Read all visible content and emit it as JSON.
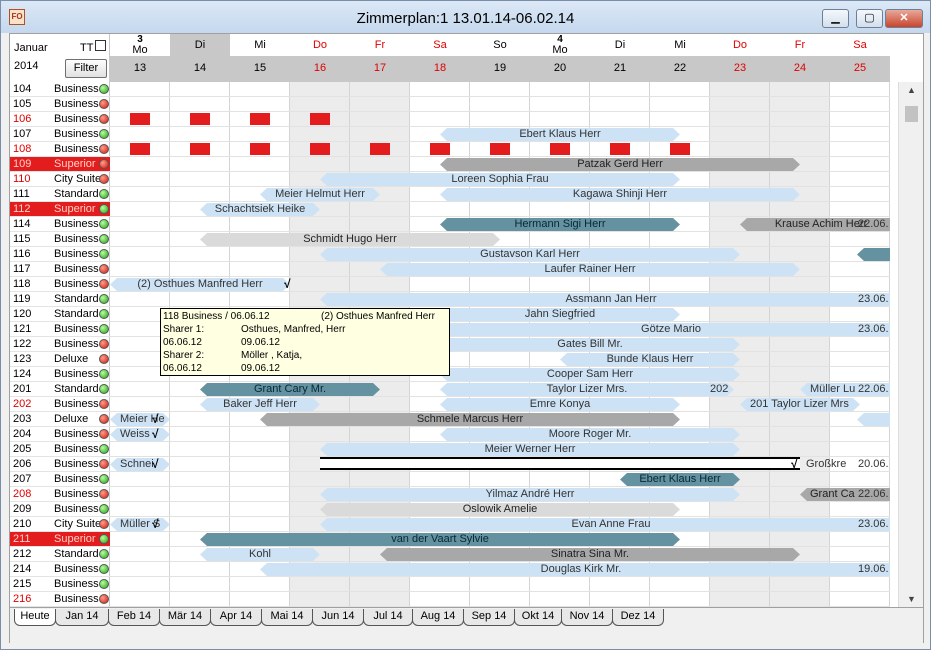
{
  "window": {
    "title": "Zimmerplan:1 13.01.14-06.02.14",
    "app_icon_label": "FO",
    "min_glyph": "▁",
    "max_glyph": "▢",
    "close_glyph": "✕"
  },
  "header": {
    "month": "Januar",
    "year": "2014",
    "tt_label": "TT",
    "filter_label": "Filter"
  },
  "days": [
    {
      "kw": "3",
      "wd": "Mo",
      "num": "13",
      "red": false,
      "today": false
    },
    {
      "kw": "",
      "wd": "Di",
      "num": "14",
      "red": false,
      "today": true
    },
    {
      "kw": "",
      "wd": "Mi",
      "num": "15",
      "red": false,
      "today": false
    },
    {
      "kw": "",
      "wd": "Do",
      "num": "16",
      "red": true,
      "today": false
    },
    {
      "kw": "",
      "wd": "Fr",
      "num": "17",
      "red": true,
      "today": false
    },
    {
      "kw": "",
      "wd": "Sa",
      "num": "18",
      "red": true,
      "today": false
    },
    {
      "kw": "",
      "wd": "So",
      "num": "19",
      "red": false,
      "today": false
    },
    {
      "kw": "4",
      "wd": "Mo",
      "num": "20",
      "red": false,
      "today": false
    },
    {
      "kw": "",
      "wd": "Di",
      "num": "21",
      "red": false,
      "today": false
    },
    {
      "kw": "",
      "wd": "Mi",
      "num": "22",
      "red": false,
      "today": false
    },
    {
      "kw": "",
      "wd": "Do",
      "num": "23",
      "red": true,
      "today": false
    },
    {
      "kw": "",
      "wd": "Fr",
      "num": "24",
      "red": true,
      "today": false
    },
    {
      "kw": "",
      "wd": "Sa",
      "num": "25",
      "red": true,
      "today": false
    }
  ],
  "weekend_columns": [
    3,
    4,
    10,
    11
  ],
  "rooms": [
    {
      "num": "104",
      "cat": "Business",
      "status": "g",
      "red": false,
      "blocked": false
    },
    {
      "num": "105",
      "cat": "Business",
      "status": "r",
      "red": false,
      "blocked": false
    },
    {
      "num": "106",
      "cat": "Business",
      "status": "r",
      "red": true,
      "blocked": false
    },
    {
      "num": "107",
      "cat": "Business",
      "status": "g",
      "red": false,
      "blocked": false
    },
    {
      "num": "108",
      "cat": "Business",
      "status": "r",
      "red": true,
      "blocked": false
    },
    {
      "num": "109",
      "cat": "Superior",
      "status": "r",
      "red": false,
      "blocked": true
    },
    {
      "num": "110",
      "cat": "City Suite",
      "status": "r",
      "red": true,
      "blocked": false
    },
    {
      "num": "111",
      "cat": "Standard",
      "status": "g",
      "red": false,
      "blocked": false
    },
    {
      "num": "112",
      "cat": "Superior",
      "status": "g",
      "red": false,
      "blocked": true
    },
    {
      "num": "114",
      "cat": "Business",
      "status": "g",
      "red": false,
      "blocked": false
    },
    {
      "num": "115",
      "cat": "Business",
      "status": "g",
      "red": false,
      "blocked": false
    },
    {
      "num": "116",
      "cat": "Business",
      "status": "g",
      "red": false,
      "blocked": false
    },
    {
      "num": "117",
      "cat": "Business",
      "status": "r",
      "red": false,
      "blocked": false
    },
    {
      "num": "118",
      "cat": "Business",
      "status": "r",
      "red": false,
      "blocked": false
    },
    {
      "num": "119",
      "cat": "Standard",
      "status": "g",
      "red": false,
      "blocked": false
    },
    {
      "num": "120",
      "cat": "Standard",
      "status": "g",
      "red": false,
      "blocked": false
    },
    {
      "num": "121",
      "cat": "Business",
      "status": "g",
      "red": false,
      "blocked": false
    },
    {
      "num": "122",
      "cat": "Business",
      "status": "r",
      "red": false,
      "blocked": false
    },
    {
      "num": "123",
      "cat": "Deluxe",
      "status": "r",
      "red": false,
      "blocked": false
    },
    {
      "num": "124",
      "cat": "Business",
      "status": "g",
      "red": false,
      "blocked": false
    },
    {
      "num": "201",
      "cat": "Standard",
      "status": "g",
      "red": false,
      "blocked": false
    },
    {
      "num": "202",
      "cat": "Business",
      "status": "r",
      "red": true,
      "blocked": false
    },
    {
      "num": "203",
      "cat": "Deluxe",
      "status": "r",
      "red": false,
      "blocked": false
    },
    {
      "num": "204",
      "cat": "Business",
      "status": "r",
      "red": false,
      "blocked": false
    },
    {
      "num": "205",
      "cat": "Business",
      "status": "g",
      "red": false,
      "blocked": false
    },
    {
      "num": "206",
      "cat": "Business",
      "status": "r",
      "red": false,
      "blocked": false
    },
    {
      "num": "207",
      "cat": "Business",
      "status": "g",
      "red": false,
      "blocked": false
    },
    {
      "num": "208",
      "cat": "Business",
      "status": "r",
      "red": true,
      "blocked": false
    },
    {
      "num": "209",
      "cat": "Business",
      "status": "g",
      "red": false,
      "blocked": false
    },
    {
      "num": "210",
      "cat": "City Suite",
      "status": "r",
      "red": false,
      "blocked": false
    },
    {
      "num": "211",
      "cat": "Superior",
      "status": "g",
      "red": false,
      "blocked": true
    },
    {
      "num": "212",
      "cat": "Standard",
      "status": "g",
      "red": false,
      "blocked": false
    },
    {
      "num": "214",
      "cat": "Business",
      "status": "g",
      "red": false,
      "blocked": false
    },
    {
      "num": "215",
      "cat": "Business",
      "status": "g",
      "red": false,
      "blocked": false
    },
    {
      "num": "216",
      "cat": "Business",
      "status": "r",
      "red": true,
      "blocked": false
    }
  ],
  "blocks": [
    {
      "row": 2,
      "day": 0
    },
    {
      "row": 2,
      "day": 1
    },
    {
      "row": 2,
      "day": 2
    },
    {
      "row": 2,
      "day": 3
    },
    {
      "row": 4,
      "day": 0
    },
    {
      "row": 4,
      "day": 1
    },
    {
      "row": 4,
      "day": 2
    },
    {
      "row": 4,
      "day": 3
    },
    {
      "row": 4,
      "day": 4
    },
    {
      "row": 4,
      "day": 5
    },
    {
      "row": 4,
      "day": 6
    },
    {
      "row": 4,
      "day": 7
    },
    {
      "row": 4,
      "day": 8
    },
    {
      "row": 4,
      "day": 9
    }
  ],
  "bookings": [
    {
      "row": 3,
      "start": 5.5,
      "end": 9.5,
      "label": "Ebert Klaus Herr",
      "style": "l"
    },
    {
      "row": 5,
      "start": 5.5,
      "end": 11.5,
      "label": "Patzak Gerd Herr",
      "style": "g"
    },
    {
      "row": 6,
      "start": 3.5,
      "end": 9.5,
      "label": "Loreen Sophia Frau",
      "style": "l"
    },
    {
      "row": 7,
      "start": 2.5,
      "end": 4.5,
      "label": "Meier Helmut Herr",
      "style": "l"
    },
    {
      "row": 7,
      "start": 5.5,
      "end": 11.5,
      "label": "Kagawa Shinji Herr",
      "style": "l"
    },
    {
      "row": 8,
      "start": 1.5,
      "end": 3.5,
      "label": "Schachtsiek Heike",
      "style": "l"
    },
    {
      "row": 9,
      "start": 5.5,
      "end": 9.5,
      "label": "Hermann Sigi Herr",
      "style": "d"
    },
    {
      "row": 9,
      "start": 10.5,
      "end": 13.2,
      "label": "Krause Achim Herr",
      "style": "g",
      "open": "r"
    },
    {
      "row": 10,
      "start": 1.5,
      "end": 6.5,
      "label": "Schmidt Hugo Herr",
      "style": "w"
    },
    {
      "row": 11,
      "start": 3.5,
      "end": 10.5,
      "label": "Gustavson Karl Herr",
      "style": "l"
    },
    {
      "row": 11,
      "start": 12.45,
      "end": 13.2,
      "label": "",
      "style": "d",
      "open": "r"
    },
    {
      "row": 12,
      "start": 4.5,
      "end": 11.5,
      "label": "Laufer Rainer Herr",
      "style": "l"
    },
    {
      "row": 13,
      "start": 0.0,
      "end": 3.0,
      "label": "(2) Osthues Manfred Herr",
      "style": "l"
    },
    {
      "row": 14,
      "start": 3.5,
      "end": 13.2,
      "label": "Assmann Jan Herr",
      "style": "l",
      "open": "r"
    },
    {
      "row": 15,
      "start": 5.5,
      "end": 9.5,
      "label": "Jahn Siegfried",
      "style": "l"
    },
    {
      "row": 16,
      "start": 5.5,
      "end": 13.2,
      "label": "Götze Mario",
      "style": "l",
      "open": "r"
    },
    {
      "row": 17,
      "start": 5.5,
      "end": 10.5,
      "label": "Gates Bill Mr.",
      "style": "l"
    },
    {
      "row": 18,
      "start": 7.5,
      "end": 10.5,
      "label": "Bunde Klaus Herr",
      "style": "l"
    },
    {
      "row": 19,
      "start": 5.5,
      "end": 10.5,
      "label": "Cooper Sam Herr",
      "style": "l"
    },
    {
      "row": 20,
      "start": 1.5,
      "end": 4.5,
      "label": "Grant Cary Mr.",
      "style": "d"
    },
    {
      "row": 20,
      "start": 5.5,
      "end": 10.4,
      "label": "Taylor Lizer Mrs.",
      "style": "l"
    },
    {
      "row": 20,
      "start": 11.5,
      "end": 13.2,
      "label": "Müller Lu",
      "style": "l",
      "open": "r",
      "align": "left"
    },
    {
      "row": 21,
      "start": 1.5,
      "end": 3.5,
      "label": "Baker Jeff Herr",
      "style": "l"
    },
    {
      "row": 21,
      "start": 5.5,
      "end": 9.5,
      "label": "Emre Konya",
      "style": "l"
    },
    {
      "row": 21,
      "start": 10.5,
      "end": 12.5,
      "label": "201 Taylor Lizer Mrs",
      "style": "l",
      "align": "left"
    },
    {
      "row": 22,
      "start": 0.0,
      "end": 1.0,
      "label": "Meier He",
      "style": "l",
      "align": "left"
    },
    {
      "row": 22,
      "start": 2.5,
      "end": 9.5,
      "label": "Schmele Marcus Herr",
      "style": "g"
    },
    {
      "row": 22,
      "start": 12.45,
      "end": 13.2,
      "label": "",
      "style": "l",
      "open": "r"
    },
    {
      "row": 23,
      "start": 0.0,
      "end": 1.0,
      "label": "Weiss",
      "style": "l",
      "align": "left"
    },
    {
      "row": 23,
      "start": 5.5,
      "end": 10.5,
      "label": "Moore Roger Mr.",
      "style": "l"
    },
    {
      "row": 24,
      "start": 3.5,
      "end": 10.5,
      "label": "Meier Werner Herr",
      "style": "l"
    },
    {
      "row": 25,
      "start": 0.0,
      "end": 1.0,
      "label": "Schnei",
      "style": "l",
      "align": "left"
    },
    {
      "row": 26,
      "start": 8.5,
      "end": 10.5,
      "label": "Ebert Klaus Herr",
      "style": "d"
    },
    {
      "row": 27,
      "start": 3.5,
      "end": 10.5,
      "label": "Yilmaz André Herr",
      "style": "l"
    },
    {
      "row": 27,
      "start": 11.5,
      "end": 13.2,
      "label": "Grant Ca",
      "style": "g",
      "open": "r",
      "align": "left"
    },
    {
      "row": 28,
      "start": 3.5,
      "end": 9.5,
      "label": "Oslowik Amelie",
      "style": "w"
    },
    {
      "row": 29,
      "start": 0.0,
      "end": 1.0,
      "label": "Müller S",
      "style": "l",
      "align": "left"
    },
    {
      "row": 29,
      "start": 3.5,
      "end": 13.2,
      "label": "Evan Anne Frau",
      "style": "l",
      "open": "r"
    },
    {
      "row": 30,
      "start": 1.5,
      "end": 9.5,
      "label": "van der Vaart Sylvie",
      "style": "d"
    },
    {
      "row": 31,
      "start": 1.5,
      "end": 3.5,
      "label": "Kohl",
      "style": "l"
    },
    {
      "row": 31,
      "start": 4.5,
      "end": 11.5,
      "label": "Sinatra Sina Mr.",
      "style": "g"
    },
    {
      "row": 32,
      "start": 2.5,
      "end": 13.2,
      "label": "Douglas Kirk Mr.",
      "style": "l",
      "open": "r"
    }
  ],
  "hollow_booking": {
    "row": 25,
    "start": 3.5,
    "end": 11.5,
    "label": ""
  },
  "end_labels": [
    {
      "row": 9,
      "text": "22.06."
    },
    {
      "row": 14,
      "text": "23.06."
    },
    {
      "row": 16,
      "text": "23.06."
    },
    {
      "row": 20,
      "text": "22.06."
    },
    {
      "row": 25,
      "text": "20.06."
    },
    {
      "row": 27,
      "text": "22.06."
    },
    {
      "row": 29,
      "text": "23.06."
    },
    {
      "row": 32,
      "text": "19.06."
    }
  ],
  "inline_labels": [
    {
      "row": 20,
      "day": 10.0,
      "text": "202"
    },
    {
      "row": 25,
      "day": 11.6,
      "text": "Großkre"
    }
  ],
  "checkmarks": [
    {
      "row": 13,
      "day": 2.9,
      "glyph": "√"
    },
    {
      "row": 22,
      "day": 0.7,
      "glyph": "√"
    },
    {
      "row": 23,
      "day": 0.7,
      "glyph": "√"
    },
    {
      "row": 25,
      "day": 0.7,
      "glyph": "√"
    },
    {
      "row": 25,
      "day": 11.35,
      "glyph": "√"
    },
    {
      "row": 29,
      "day": 0.7,
      "glyph": "√"
    }
  ],
  "tooltip": {
    "line1_left": "118 Business / 06.06.12",
    "line1_right": "(2) Osthues Manfred Herr",
    "sharer1_label": "Sharer 1:",
    "sharer1_name": "Osthues, Manfred, Herr",
    "sharer1_from": "06.06.12",
    "sharer1_to": "09.06.12",
    "sharer2_label": "Sharer 2:",
    "sharer2_name": "Möller , Katja,",
    "sharer2_from": "06.06.12",
    "sharer2_to": "09.06.12"
  },
  "tabs": [
    "Heute",
    "Jan 14",
    "Feb 14",
    "Mär 14",
    "Apr 14",
    "Mai 14",
    "Jun 14",
    "Jul 14",
    "Aug 14",
    "Sep 14",
    "Okt 14",
    "Nov 14",
    "Dez 14"
  ],
  "active_tab": 0,
  "scroll": {
    "up_glyph": "▲",
    "down_glyph": "▼"
  }
}
